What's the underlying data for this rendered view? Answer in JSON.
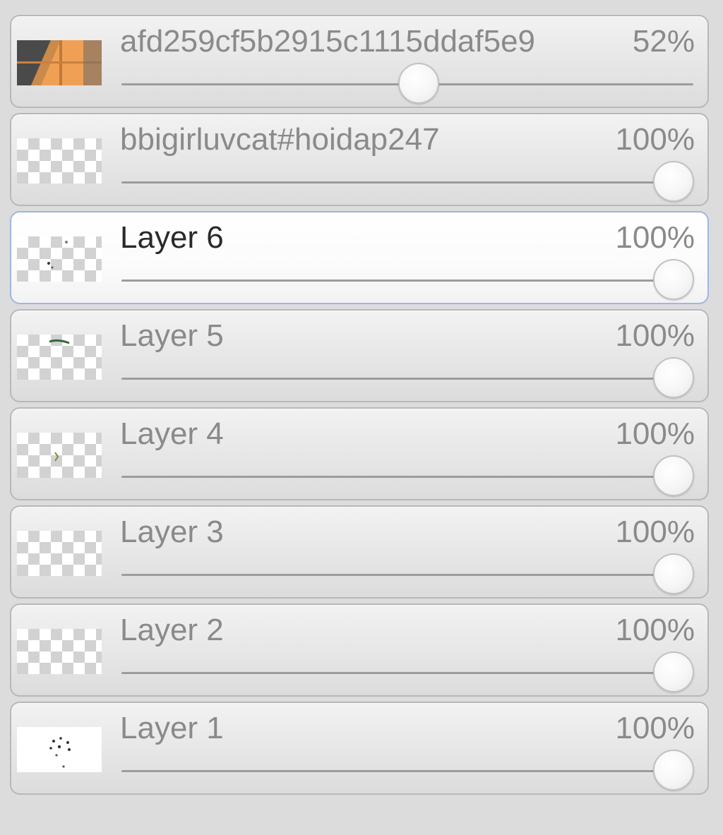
{
  "layers": [
    {
      "name": "afd259cf5b2915c1115ddaf5e9",
      "opacity_label": "52%",
      "opacity": 0.52,
      "selected": false,
      "thumbnail": "photo-thumbnail"
    },
    {
      "name": "bbigirluvcat#hoidap247",
      "opacity_label": "100%",
      "opacity": 1.0,
      "selected": false,
      "thumbnail": "transparent-thumbnail"
    },
    {
      "name": "Layer 6",
      "opacity_label": "100%",
      "opacity": 1.0,
      "selected": true,
      "thumbnail": "sketch-thumbnail"
    },
    {
      "name": "Layer 5",
      "opacity_label": "100%",
      "opacity": 1.0,
      "selected": false,
      "thumbnail": "sketch-thumbnail"
    },
    {
      "name": "Layer 4",
      "opacity_label": "100%",
      "opacity": 1.0,
      "selected": false,
      "thumbnail": "sketch-thumbnail"
    },
    {
      "name": "Layer 3",
      "opacity_label": "100%",
      "opacity": 1.0,
      "selected": false,
      "thumbnail": "transparent-thumbnail"
    },
    {
      "name": "Layer 2",
      "opacity_label": "100%",
      "opacity": 1.0,
      "selected": false,
      "thumbnail": "transparent-thumbnail"
    },
    {
      "name": "Layer 1",
      "opacity_label": "100%",
      "opacity": 1.0,
      "selected": false,
      "thumbnail": "white-sketch-thumbnail"
    }
  ],
  "colors": {
    "selected_border": "#9fb6e0",
    "panel_background": "#dcdcdc",
    "text_muted": "#8a8a8a",
    "text_selected": "#2a2a2a"
  }
}
